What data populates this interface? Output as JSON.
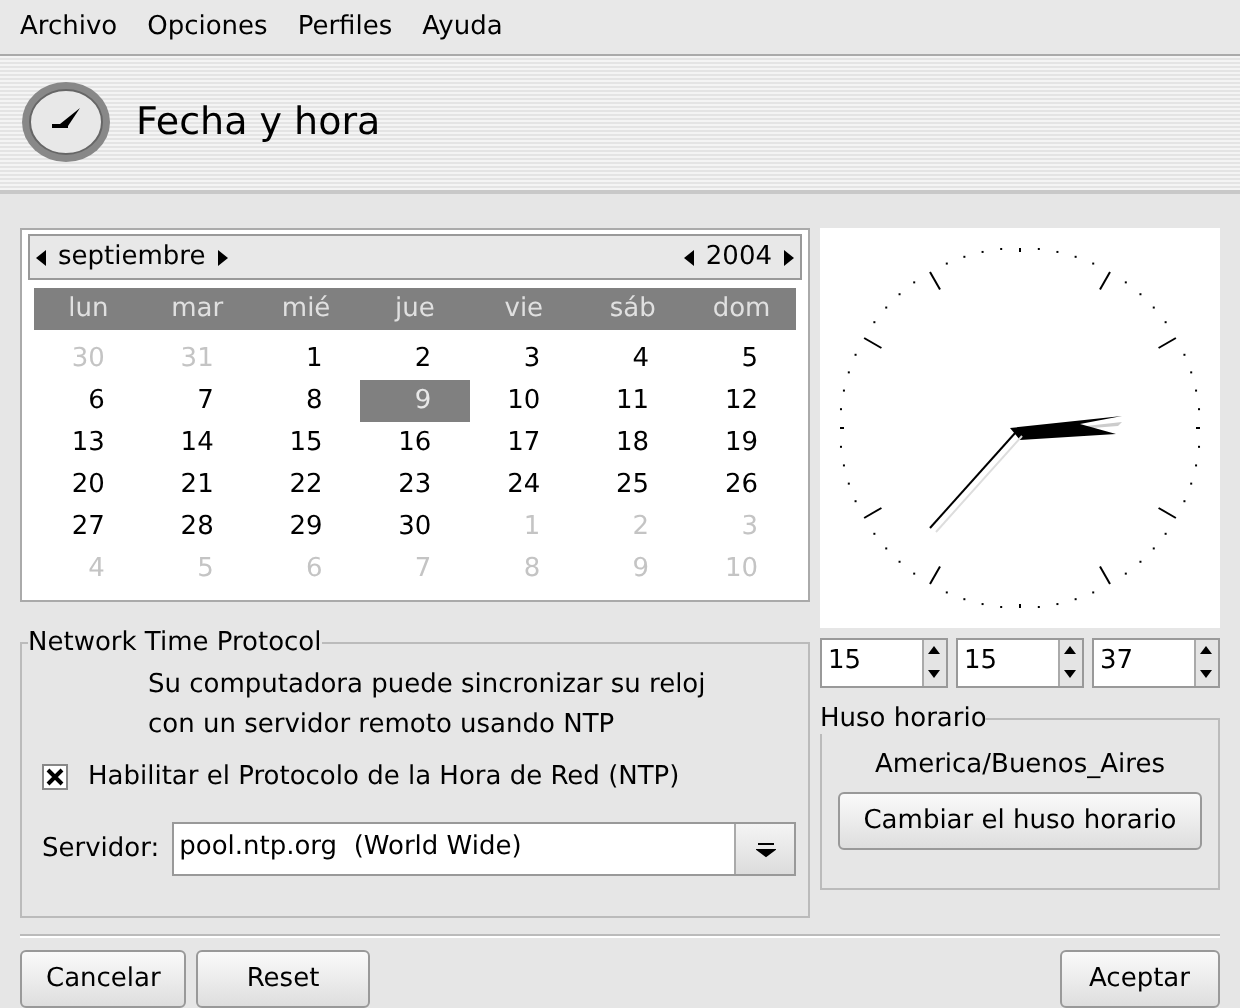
{
  "menu": [
    "Archivo",
    "Opciones",
    "Perfiles",
    "Ayuda"
  ],
  "header": {
    "title": "Fecha y hora"
  },
  "calendar": {
    "month": "septiembre",
    "year": "2004",
    "weekdays": [
      "lun",
      "mar",
      "mié",
      "jue",
      "vie",
      "sáb",
      "dom"
    ],
    "days": [
      {
        "label": "30",
        "other_month": true,
        "selected": false
      },
      {
        "label": "31",
        "other_month": true,
        "selected": false
      },
      {
        "label": "1",
        "other_month": false,
        "selected": false
      },
      {
        "label": "2",
        "other_month": false,
        "selected": false
      },
      {
        "label": "3",
        "other_month": false,
        "selected": false
      },
      {
        "label": "4",
        "other_month": false,
        "selected": false
      },
      {
        "label": "5",
        "other_month": false,
        "selected": false
      },
      {
        "label": "6",
        "other_month": false,
        "selected": false
      },
      {
        "label": "7",
        "other_month": false,
        "selected": false
      },
      {
        "label": "8",
        "other_month": false,
        "selected": false
      },
      {
        "label": "9",
        "other_month": false,
        "selected": true
      },
      {
        "label": "10",
        "other_month": false,
        "selected": false
      },
      {
        "label": "11",
        "other_month": false,
        "selected": false
      },
      {
        "label": "12",
        "other_month": false,
        "selected": false
      },
      {
        "label": "13",
        "other_month": false,
        "selected": false
      },
      {
        "label": "14",
        "other_month": false,
        "selected": false
      },
      {
        "label": "15",
        "other_month": false,
        "selected": false
      },
      {
        "label": "16",
        "other_month": false,
        "selected": false
      },
      {
        "label": "17",
        "other_month": false,
        "selected": false
      },
      {
        "label": "18",
        "other_month": false,
        "selected": false
      },
      {
        "label": "19",
        "other_month": false,
        "selected": false
      },
      {
        "label": "20",
        "other_month": false,
        "selected": false
      },
      {
        "label": "21",
        "other_month": false,
        "selected": false
      },
      {
        "label": "22",
        "other_month": false,
        "selected": false
      },
      {
        "label": "23",
        "other_month": false,
        "selected": false
      },
      {
        "label": "24",
        "other_month": false,
        "selected": false
      },
      {
        "label": "25",
        "other_month": false,
        "selected": false
      },
      {
        "label": "26",
        "other_month": false,
        "selected": false
      },
      {
        "label": "27",
        "other_month": false,
        "selected": false
      },
      {
        "label": "28",
        "other_month": false,
        "selected": false
      },
      {
        "label": "29",
        "other_month": false,
        "selected": false
      },
      {
        "label": "30",
        "other_month": false,
        "selected": false
      },
      {
        "label": "1",
        "other_month": true,
        "selected": false
      },
      {
        "label": "2",
        "other_month": true,
        "selected": false
      },
      {
        "label": "3",
        "other_month": true,
        "selected": false
      },
      {
        "label": "4",
        "other_month": true,
        "selected": false
      },
      {
        "label": "5",
        "other_month": true,
        "selected": false
      },
      {
        "label": "6",
        "other_month": true,
        "selected": false
      },
      {
        "label": "7",
        "other_month": true,
        "selected": false
      },
      {
        "label": "8",
        "other_month": true,
        "selected": false
      },
      {
        "label": "9",
        "other_month": true,
        "selected": false
      },
      {
        "label": "10",
        "other_month": true,
        "selected": false
      }
    ]
  },
  "time": {
    "hours": "15",
    "minutes": "15",
    "seconds": "37"
  },
  "ntp": {
    "title": "Network Time Protocol",
    "description": "Su computadora puede sincronizar su reloj con un servidor remoto usando NTP",
    "enable_label": "Habilitar el Protocolo de la Hora de Red (NTP)",
    "enabled": true,
    "server_label": "Servidor:",
    "server": "pool.ntp.org  (World Wide)"
  },
  "timezone": {
    "title": "Huso horario",
    "value": "America/Buenos_Aires",
    "button": "Cambiar el huso horario"
  },
  "buttons": {
    "cancel": "Cancelar",
    "reset": "Reset",
    "ok": "Aceptar"
  }
}
